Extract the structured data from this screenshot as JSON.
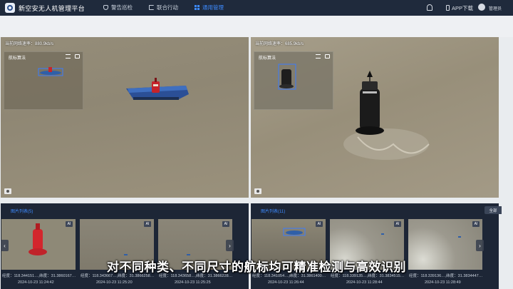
{
  "header": {
    "app_title": "新空安无人机管理平台",
    "nav": [
      {
        "label": "警告巡检",
        "icon": "shield-icon"
      },
      {
        "label": "联合行动",
        "icon": "flag-icon"
      },
      {
        "label": "通用管理",
        "icon": "grid-icon",
        "active": true
      }
    ],
    "app_download": "APP下载",
    "user_name": "管理员",
    "accent_color": "#3d8bff"
  },
  "video_panels": [
    {
      "speed": "当前网络速率：880.9kb/s",
      "algo_title": "航标算法"
    },
    {
      "speed": "当前网络速率：685.9kb/s",
      "algo_title": "航标算法"
    }
  ],
  "galleries": [
    {
      "title": "图片列表(5)",
      "items": [
        {
          "badge": "AI",
          "coords": "经度：118.344151…,纬度：31.3860167…",
          "time": "2024-10-23 11:24:42"
        },
        {
          "badge": "AI",
          "coords": "经度：118.343667…,纬度：31.3866258…",
          "time": "2024-10-23 11:25:20"
        },
        {
          "badge": "AI",
          "coords": "经度：118.343658…,纬度：31.3866228…",
          "time": "2024-10-23 11:25:25"
        }
      ]
    },
    {
      "title": "图片列表(11)",
      "all_label": "全部",
      "items": [
        {
          "badge": "AI",
          "coords": "经度：118.341054…,纬度：31.3861400…",
          "time": "2024-10-23 11:26:44"
        },
        {
          "badge": "AI",
          "coords": "经度：118.339135…,纬度：31.3834515…",
          "time": "2024-10-23 11:28:44"
        },
        {
          "badge": "AI",
          "coords": "经度：118.339136…,纬度：31.3834447…",
          "time": "2024-10-23 11:28:49"
        }
      ]
    }
  ],
  "caption": "对不同种类、不同尺寸的航标均可精准检测与高效识别"
}
